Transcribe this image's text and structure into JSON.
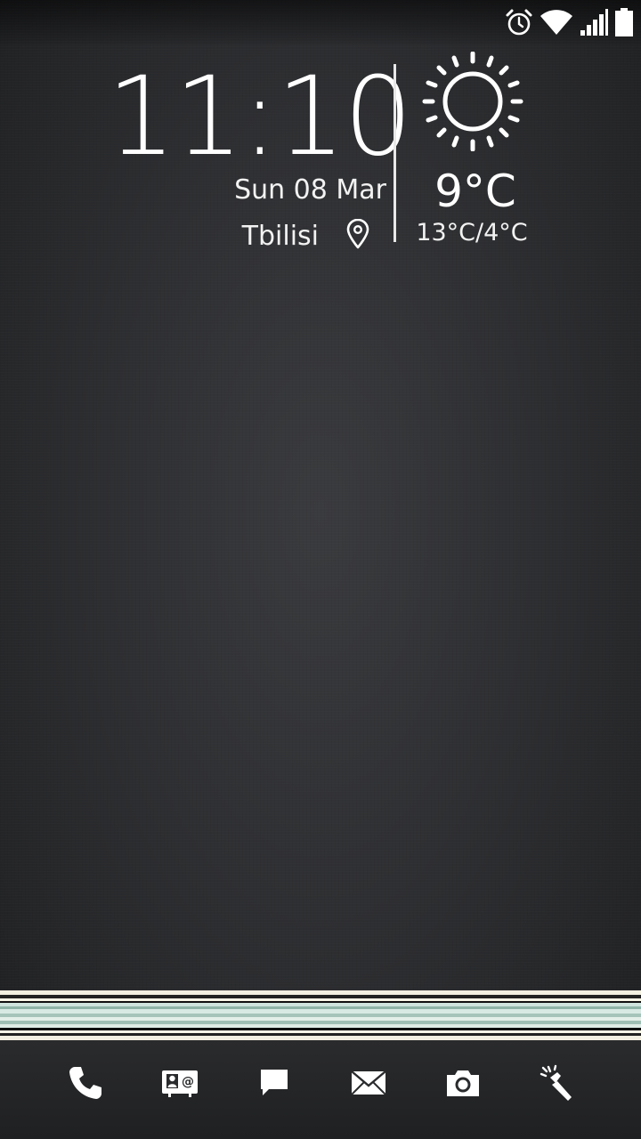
{
  "status_bar": {
    "icons": [
      "alarm-icon",
      "wifi-icon",
      "signal-icon",
      "battery-icon"
    ]
  },
  "clock_widget": {
    "time": "11:10",
    "date": "Sun 08 Mar",
    "city": "Tbilisi",
    "location_icon": "location-pin-icon"
  },
  "weather_widget": {
    "icon": "sun-icon",
    "temperature": "9°C",
    "range": "13°C/4°C"
  },
  "dock": {
    "items": [
      {
        "name": "phone",
        "icon": "phone-icon"
      },
      {
        "name": "contacts",
        "icon": "contacts-icon"
      },
      {
        "name": "messages",
        "icon": "message-icon"
      },
      {
        "name": "email",
        "icon": "email-icon"
      },
      {
        "name": "camera",
        "icon": "camera-icon"
      },
      {
        "name": "flashlight",
        "icon": "flashlight-icon"
      }
    ]
  },
  "colors": {
    "background": "#2e2f32",
    "text": "#ffffff",
    "stripe_accent": "#8fb4a8"
  }
}
